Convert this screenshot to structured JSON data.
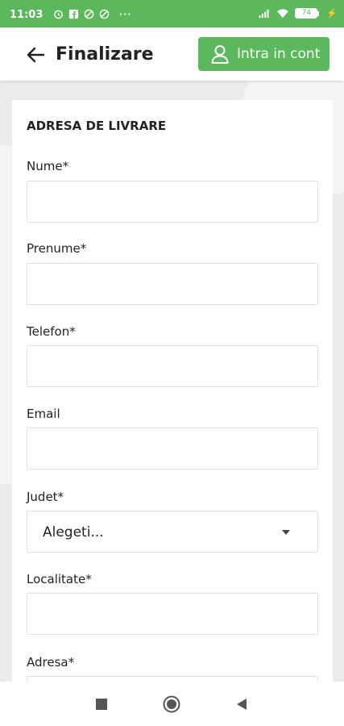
{
  "status_bar": {
    "time": "11:03",
    "left_icons": [
      "alarm-icon",
      "facebook-icon",
      "blocked-icon",
      "blocked-icon"
    ],
    "overflow": "···",
    "battery_level": "74",
    "right_icons": [
      "signal-icon",
      "wifi-icon",
      "battery-icon",
      "charging-icon"
    ]
  },
  "app_bar": {
    "title": "Finalizare",
    "back_icon": "arrow-left-icon",
    "login_label": "Intra in cont",
    "login_icon": "user-icon"
  },
  "form": {
    "section_title": "ADRESA DE LIVRARE",
    "fields": [
      {
        "label": "Nume*",
        "value": ""
      },
      {
        "label": "Prenume*",
        "value": ""
      },
      {
        "label": "Telefon*",
        "value": ""
      },
      {
        "label": "Email",
        "value": ""
      },
      {
        "label": "Judet*",
        "value": "Alegeti..."
      },
      {
        "label": "Localitate*",
        "value": ""
      },
      {
        "label": "Adresa*",
        "value": ""
      }
    ]
  },
  "nav_bar": {
    "buttons": [
      "recents-icon",
      "home-icon",
      "back-triangle-icon"
    ]
  },
  "colors": {
    "accent": "#5cb85c",
    "background": "#ebebeb",
    "card": "#ffffff",
    "text": "#222222",
    "input_border": "#e0e0e0"
  }
}
